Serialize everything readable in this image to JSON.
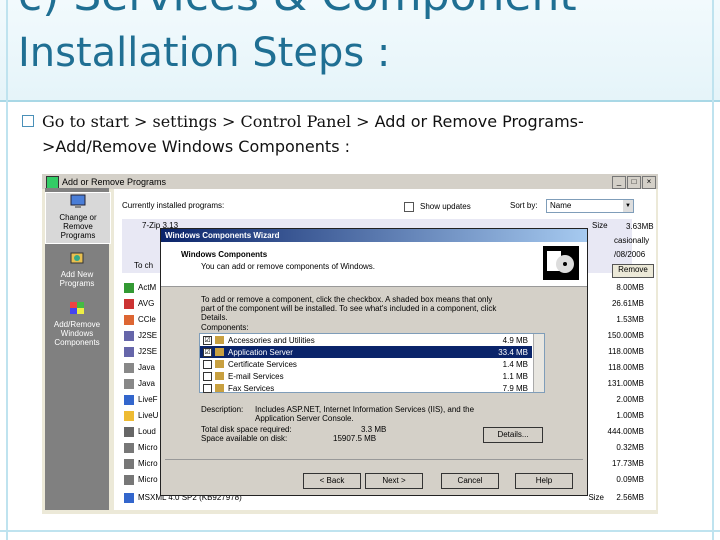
{
  "slide": {
    "title_line1": "c) Services & Component",
    "title_line2": "Installation Steps :",
    "bullet_serif": "Go to start > settings > Control Panel > ",
    "bullet_sans": "Add or Remove Programs-",
    "bullet_line2": ">Add/Remove Windows Components :"
  },
  "window": {
    "title": "Add or Remove Programs",
    "min": "_",
    "max": "□",
    "close": "×",
    "nav": [
      {
        "label": "Change or Remove Programs",
        "icon": "change-remove-icon"
      },
      {
        "label": "Add New Programs",
        "icon": "add-programs-icon"
      },
      {
        "label": "Add/Remove Windows Components",
        "icon": "windows-components-icon"
      }
    ],
    "currently_installed": "Currently installed programs:",
    "show_updates": "Show updates",
    "sort_by_label": "Sort by:",
    "sort_by_value": "Name",
    "first_program": "7-Zip 3.13",
    "size_label": "Size",
    "size_value_top": "3.63MB",
    "used_label": "casionally",
    "date_value": "/08/2006",
    "remove_label": "Remove",
    "to_ch": "To ch",
    "programs": [
      {
        "name": "ActM",
        "size": "8.00MB"
      },
      {
        "name": "AVG",
        "size": "26.61MB"
      },
      {
        "name": "CCle",
        "size": "1.53MB"
      },
      {
        "name": "J2SE",
        "size": "150.00MB"
      },
      {
        "name": "J2SE",
        "size": "118.00MB"
      },
      {
        "name": "Java",
        "size": "118.00MB"
      },
      {
        "name": "Java",
        "size": "131.00MB"
      },
      {
        "name": "LiveF",
        "size": "2.00MB"
      },
      {
        "name": "LiveU",
        "size": "1.00MB"
      },
      {
        "name": "Loud",
        "size": "444.00MB"
      },
      {
        "name": "Micro",
        "size": "0.32MB"
      },
      {
        "name": "Micro",
        "size": "17.73MB"
      },
      {
        "name": "Micro",
        "size": "0.09MB"
      }
    ],
    "last_program": "MSXML 4.0 SP2 (KB927978)",
    "last_size_label": "Size",
    "last_size_value": "2.56MB"
  },
  "wizard": {
    "title": "Windows Components Wizard",
    "heading": "Windows Components",
    "subheading": "You can add or remove components of Windows.",
    "instructions_1": "To add or remove a component, click the checkbox. A shaded box means that only",
    "instructions_2": "part of the component will be installed. To see what's included in a component, click",
    "instructions_3": "Details.",
    "components_label": "Components:",
    "components": [
      {
        "name": "Accessories and Utilities",
        "size": "4.9 MB",
        "checked": "☑"
      },
      {
        "name": "Application Server",
        "size": "33.4 MB",
        "checked": "☑"
      },
      {
        "name": "Certificate Services",
        "size": "1.4 MB",
        "checked": ""
      },
      {
        "name": "E-mail Services",
        "size": "1.1 MB",
        "checked": ""
      },
      {
        "name": "Fax Services",
        "size": "7.9 MB",
        "checked": ""
      }
    ],
    "description_label": "Description:",
    "description_1": "Includes ASP.NET, Internet Information Services (IIS), and the",
    "description_2": "Application Server Console.",
    "disk_required_label": "Total disk space required:",
    "disk_required_value": "3.3 MB",
    "disk_available_label": "Space available on disk:",
    "disk_available_value": "15907.5 MB",
    "details_button": "Details...",
    "back_button": "< Back",
    "next_button": "Next >",
    "cancel_button": "Cancel",
    "help_button": "Help"
  },
  "colors": {
    "title": "#1f6f93",
    "selection": "#0a246a"
  }
}
